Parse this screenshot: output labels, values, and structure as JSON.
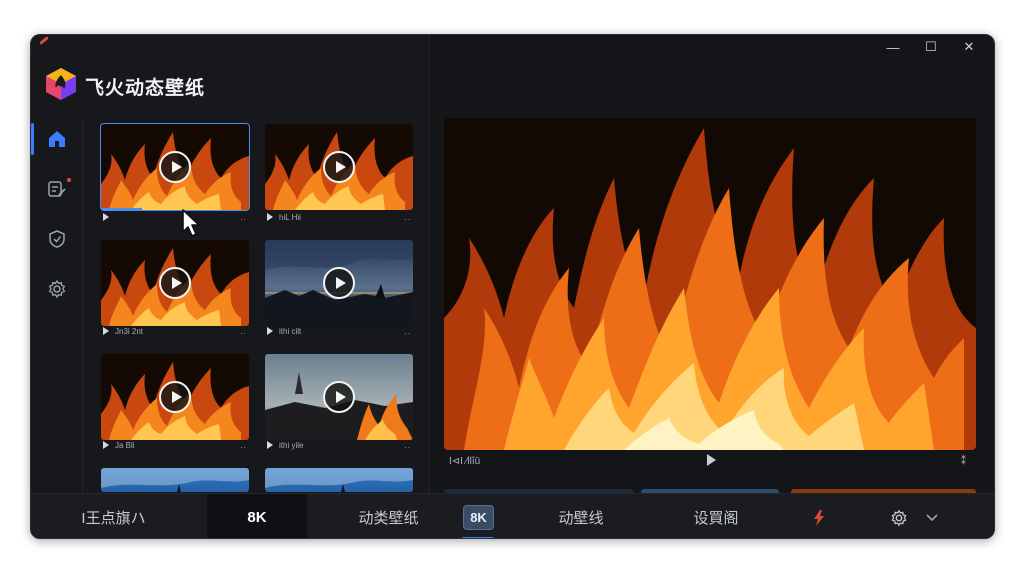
{
  "app": {
    "title": "飞火动态壁纸"
  },
  "window_controls": {
    "minimize": "—",
    "maximize": "☐",
    "close": "✕"
  },
  "nav": {
    "items": [
      {
        "name": "home",
        "icon": "home-icon",
        "active": true
      },
      {
        "name": "edit",
        "icon": "edit-icon",
        "badge": true
      },
      {
        "name": "verified",
        "icon": "shield-check-icon"
      },
      {
        "name": "settings",
        "icon": "gear-icon"
      }
    ]
  },
  "thumbnails": [
    {
      "theme": "fire",
      "caption": "",
      "selected": true,
      "progress": 0.28
    },
    {
      "theme": "fire",
      "caption": "hiL Hii"
    },
    {
      "theme": "fire",
      "caption": "Jn3i 2nt"
    },
    {
      "theme": "landscape",
      "caption": "ithi cilt"
    },
    {
      "theme": "fire",
      "caption": "Ja Bli"
    },
    {
      "theme": "castle-fire",
      "caption": "ithi yile"
    },
    {
      "theme": "sky",
      "caption": ""
    },
    {
      "theme": "sky",
      "caption": ""
    }
  ],
  "thumb_dots": "..",
  "preview": {
    "title": "I⊲I ⁄llîū",
    "right_icon": "⁑"
  },
  "bottom_bar": {
    "items": [
      {
        "label": "I王点旗ハ",
        "style": "plain"
      },
      {
        "label": "8K",
        "style": "dark"
      },
      {
        "label": "动类壁纸",
        "style": "plain"
      },
      {
        "label": "8K",
        "style": "badge"
      },
      {
        "label": "动壁线",
        "style": "plain"
      },
      {
        "label": "设買阁",
        "style": "plain"
      }
    ],
    "accent_icon": "lightning-icon",
    "settings_icon": "gear-icon",
    "dropdown_icon": "chevron-down-icon"
  },
  "colors": {
    "accent": "#3a7bff",
    "background": "#141518",
    "notification": "#e5483f"
  }
}
